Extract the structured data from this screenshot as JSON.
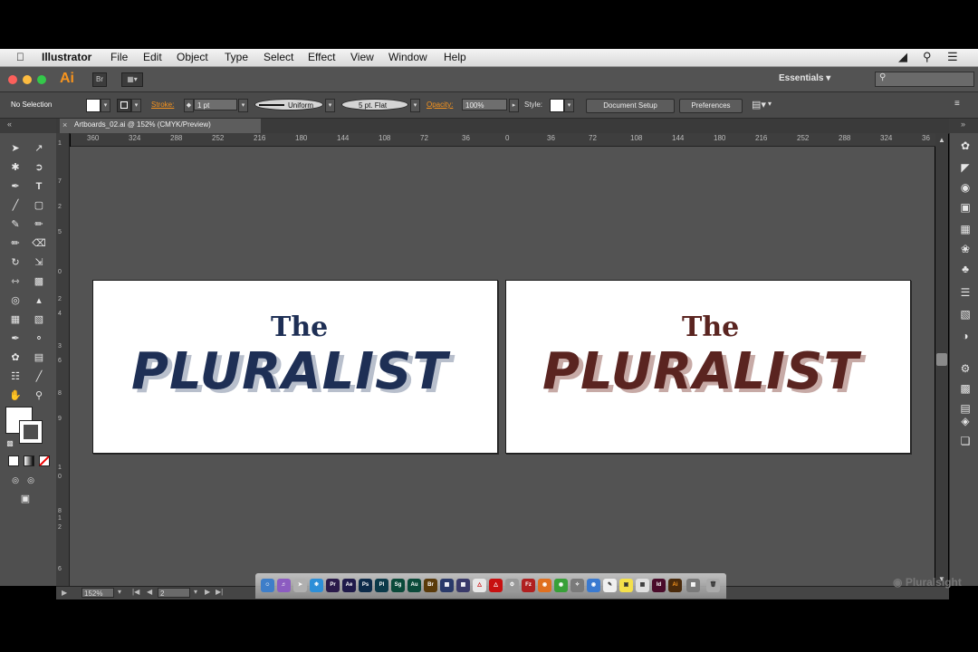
{
  "menubar": {
    "apple": "",
    "app_name": "Illustrator",
    "items": [
      "File",
      "Edit",
      "Object",
      "Type",
      "Select",
      "Effect",
      "View",
      "Window",
      "Help"
    ]
  },
  "appbar": {
    "logo": "Ai",
    "bridge_label": "Br",
    "workspace": "Essentials",
    "workspace_arrow": "▾"
  },
  "control_bar": {
    "selection": "No Selection",
    "stroke_label": "Stroke:",
    "stroke_weight": "1 pt",
    "stroke_profile": "Uniform",
    "brush": "5 pt. Flat",
    "opacity_label": "Opacity:",
    "opacity_value": "100%",
    "style_label": "Style:",
    "document_setup": "Document Setup",
    "preferences": "Preferences"
  },
  "tab": {
    "close": "×",
    "title": "Artboards_02.ai @ 152% (CMYK/Preview)"
  },
  "ruler": {
    "h_ticks": [
      "360",
      "324",
      "288",
      "252",
      "216",
      "180",
      "144",
      "108",
      "72",
      "36",
      "0",
      "36",
      "72",
      "108",
      "144",
      "180",
      "216",
      "252",
      "288",
      "324",
      "36"
    ],
    "v_ticks": [
      "1",
      "7",
      "2",
      "5",
      "0",
      "2",
      "4",
      "3",
      "6",
      "8",
      "9",
      "1",
      "0",
      "8",
      "1",
      "2",
      "6"
    ]
  },
  "artboards": [
    {
      "the": "The",
      "name": "PLURALIST",
      "color": "#1e2f55",
      "shadow": "#b8bfcc"
    },
    {
      "the": "The",
      "name": "PLURALIST",
      "color": "#5a2420",
      "shadow": "#c7aaa6"
    }
  ],
  "status_bar": {
    "zoom": "152%",
    "artboard_num": "2"
  },
  "dock_apps": [
    "Pr",
    "Ae",
    "Ps",
    "Pl",
    "Sg",
    "Au",
    "Br",
    "Ai",
    "Id",
    "Ai"
  ],
  "watermark": "Pluralsight"
}
